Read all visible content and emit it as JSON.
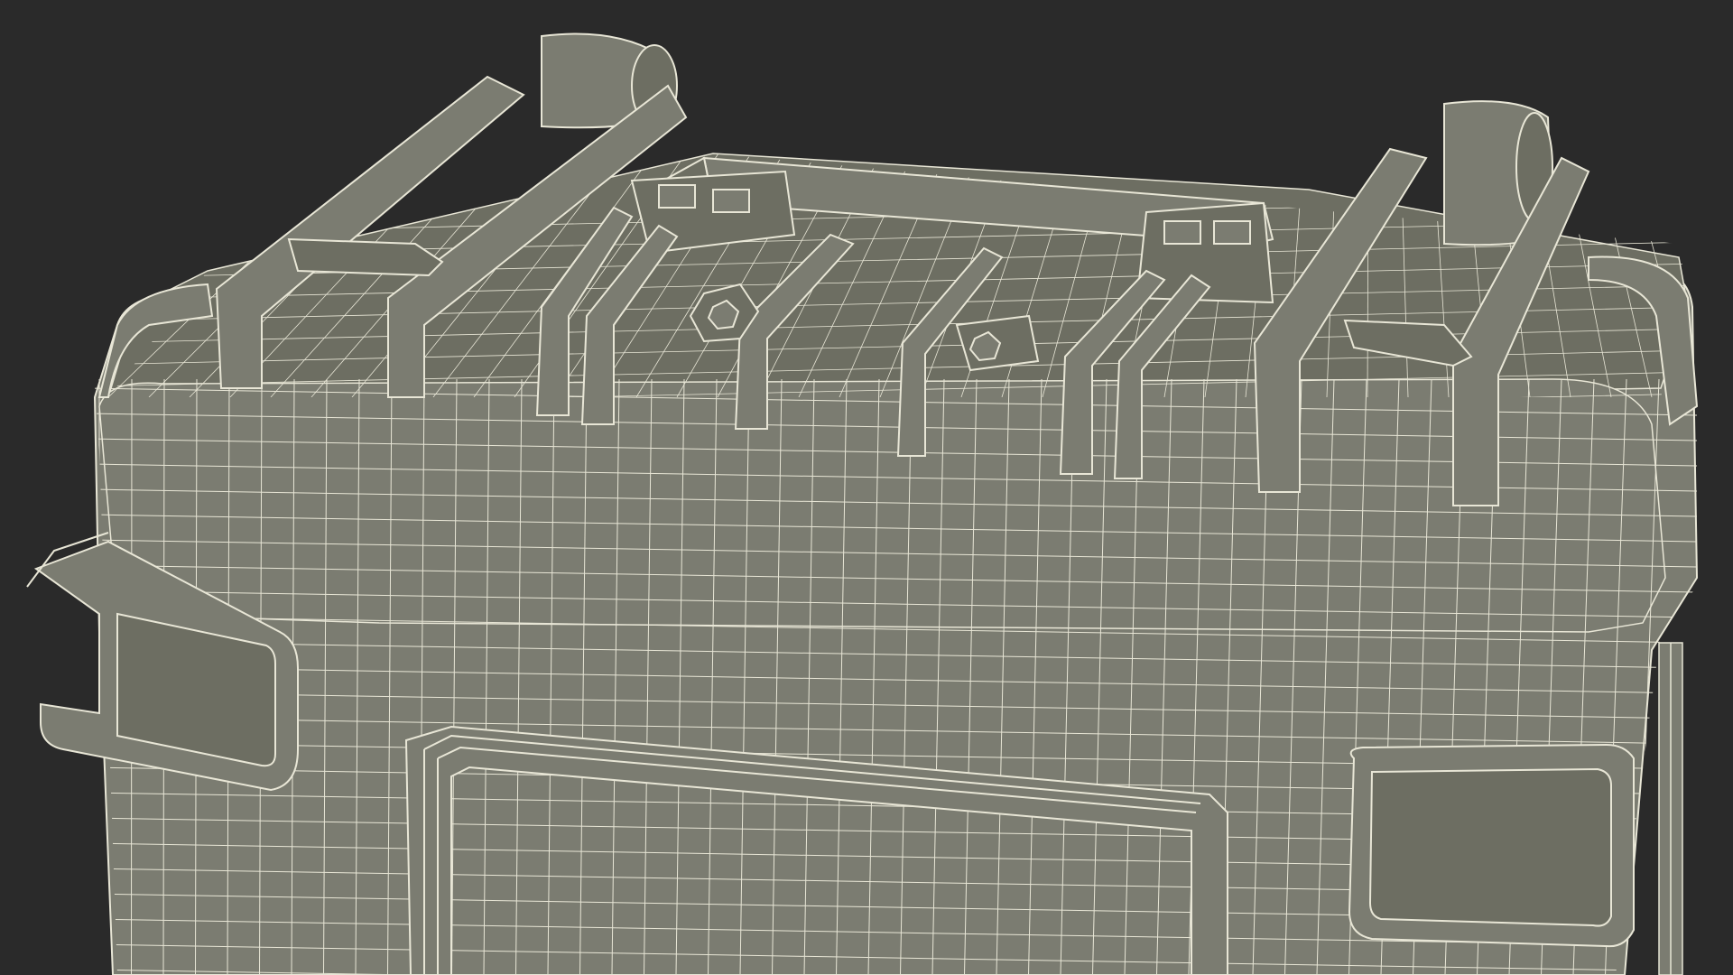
{
  "scene": {
    "subject": "wireframe-render",
    "colors": {
      "background": "#2a2a2a",
      "surface": "#7b7c71",
      "surface_dark": "#666759",
      "surface_light": "#8c8d81",
      "wire": "#e8e6d6",
      "shadow": "#55564b"
    }
  }
}
